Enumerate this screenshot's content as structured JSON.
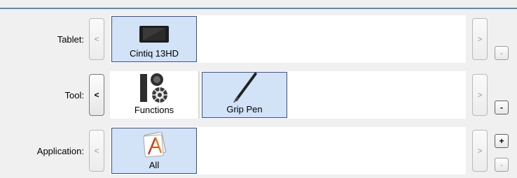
{
  "rows": {
    "tablet": {
      "label": "Tablet:",
      "scroll_left": "<",
      "scroll_right": ">",
      "items": [
        {
          "label": "Cintiq 13HD",
          "icon": "tablet-icon",
          "selected": true
        }
      ],
      "side_buttons": [
        "-"
      ]
    },
    "tool": {
      "label": "Tool:",
      "scroll_left": "<",
      "scroll_right": ">",
      "items": [
        {
          "label": "Functions",
          "icon": "functions-icon",
          "selected": false
        },
        {
          "label": "Grip Pen",
          "icon": "pen-icon",
          "selected": true
        }
      ],
      "side_buttons": [
        "-"
      ]
    },
    "application": {
      "label": "Application:",
      "scroll_left": "<",
      "scroll_right": ">",
      "items": [
        {
          "label": "All",
          "icon": "all-applications-icon",
          "selected": true
        }
      ],
      "side_buttons": [
        "+",
        "-"
      ]
    }
  },
  "colors": {
    "selected_bg": "#d2e2f7",
    "selected_border": "#3a4b9a",
    "accent_line": "#5b8cab"
  }
}
